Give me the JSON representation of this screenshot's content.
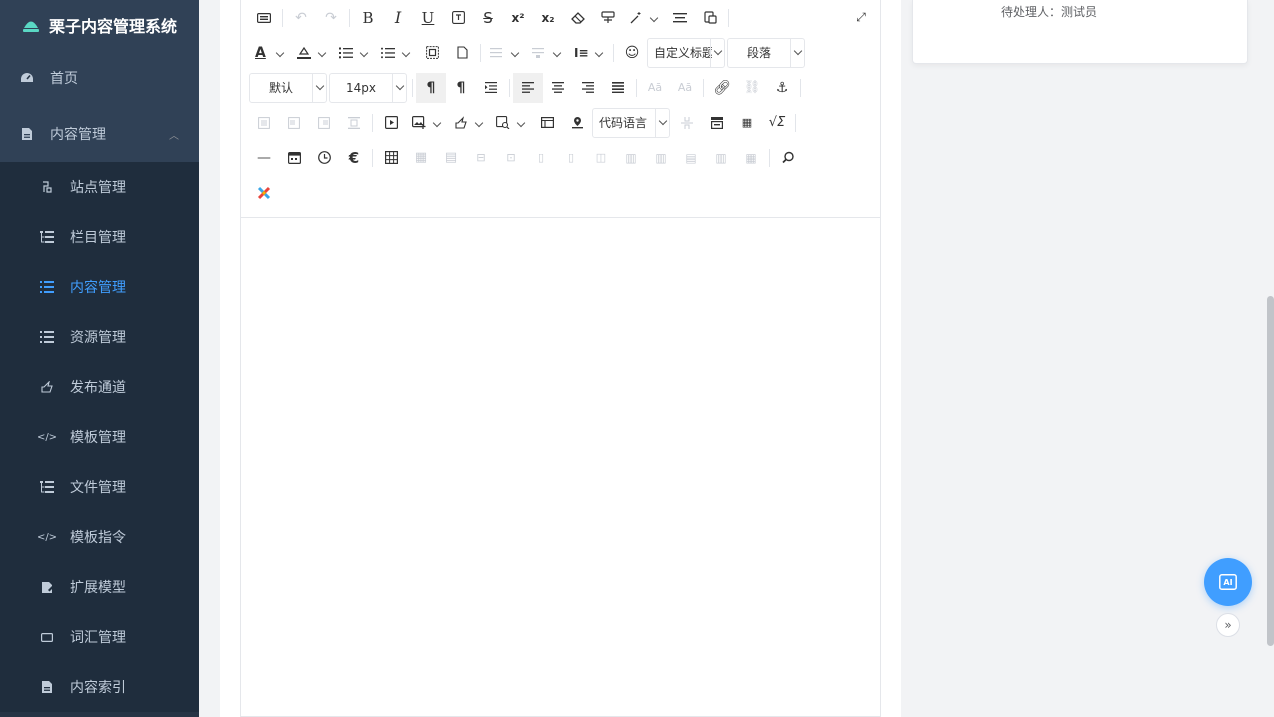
{
  "app": {
    "title": "栗子内容管理系统"
  },
  "menu": {
    "home": "首页",
    "content_group": "内容管理",
    "items": [
      {
        "label": "站点管理",
        "icon": "site-icon"
      },
      {
        "label": "栏目管理",
        "icon": "catalog-icon"
      },
      {
        "label": "内容管理",
        "icon": "list-icon",
        "active": true
      },
      {
        "label": "资源管理",
        "icon": "list-icon"
      },
      {
        "label": "发布通道",
        "icon": "publish-icon"
      },
      {
        "label": "模板管理",
        "icon": "code-icon"
      },
      {
        "label": "文件管理",
        "icon": "catalog-icon"
      },
      {
        "label": "模板指令",
        "icon": "code-icon"
      },
      {
        "label": "扩展模型",
        "icon": "model-icon"
      },
      {
        "label": "词汇管理",
        "icon": "word-icon"
      },
      {
        "label": "内容索引",
        "icon": "doc-icon"
      }
    ]
  },
  "toolbar": {
    "custom_title": "自定义标题",
    "paragraph": "段落",
    "font_default": "默认",
    "font_size": "14px",
    "code_language": "代码语言"
  },
  "right_panel": {
    "pending": "待处理人：测试员"
  },
  "floating": {
    "ai_label": "AI"
  },
  "colors": {
    "sidebar": "#263445",
    "submenu": "#1f2d3d",
    "accent": "#409eff"
  }
}
